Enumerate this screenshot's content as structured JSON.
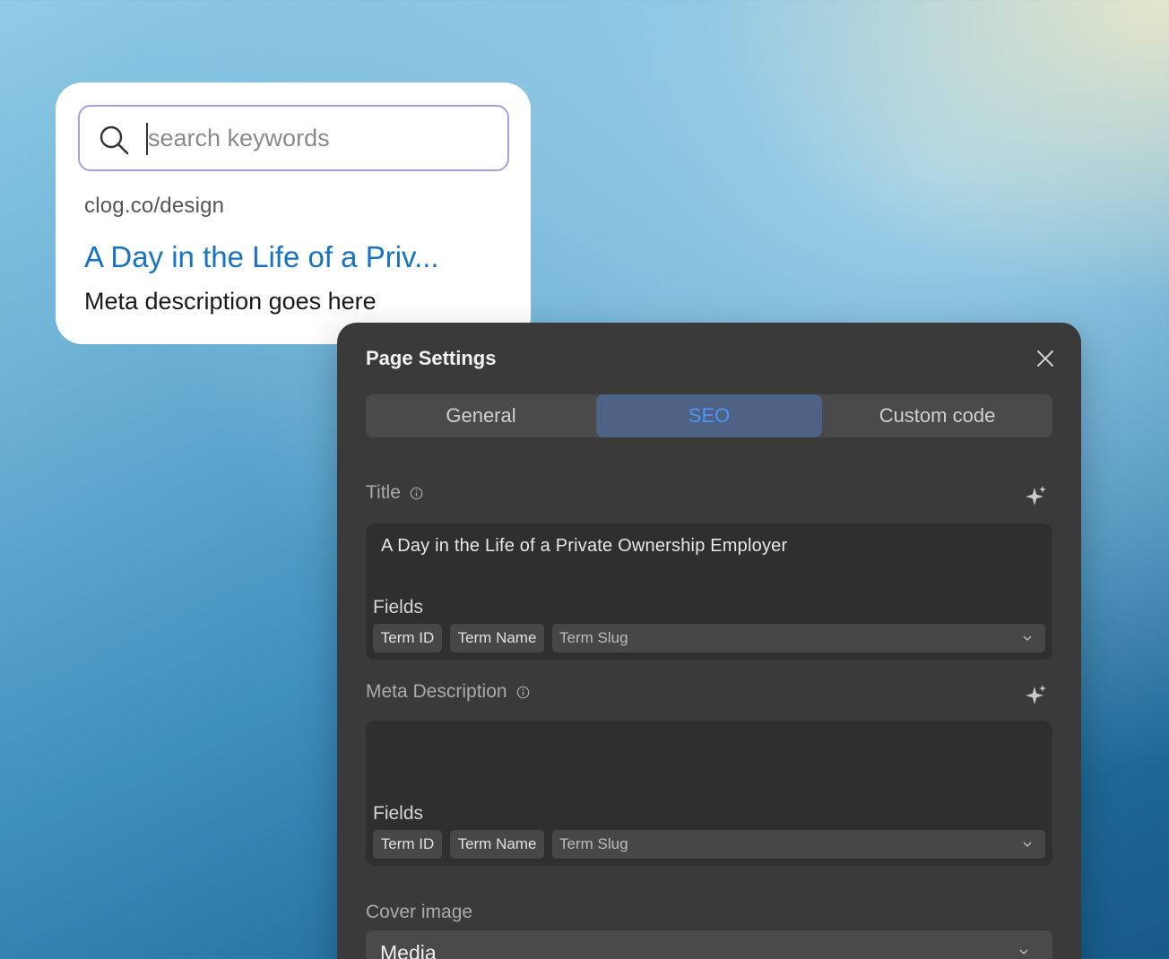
{
  "search_preview": {
    "search_placeholder": "search keywords",
    "search_value": "",
    "result_url": "clog.co/design",
    "result_title": "A Day in the Life of a Priv...",
    "result_description": "Meta description goes here"
  },
  "panel": {
    "title": "Page Settings",
    "close_icon": "close-icon",
    "tabs": [
      {
        "label": "General",
        "active": false
      },
      {
        "label": "SEO",
        "active": true
      },
      {
        "label": "Custom code",
        "active": false
      }
    ],
    "title_field": {
      "label": "Title",
      "value": "A Day in the Life of a Private Ownership Employer",
      "fields_label": "Fields",
      "chips": [
        "Term ID",
        "Term Name"
      ],
      "dropdown_value": "Term Slug"
    },
    "meta_field": {
      "label": "Meta Description",
      "value": "",
      "fields_label": "Fields",
      "chips": [
        "Term ID",
        "Term Name"
      ],
      "dropdown_value": "Term Slug"
    },
    "cover_image": {
      "label": "Cover image",
      "value": "Media"
    }
  },
  "colors": {
    "accent": "#4f95f5",
    "link": "#1673c4",
    "panel_bg": "#3a3a3a",
    "search_border": "#a99ee6"
  }
}
